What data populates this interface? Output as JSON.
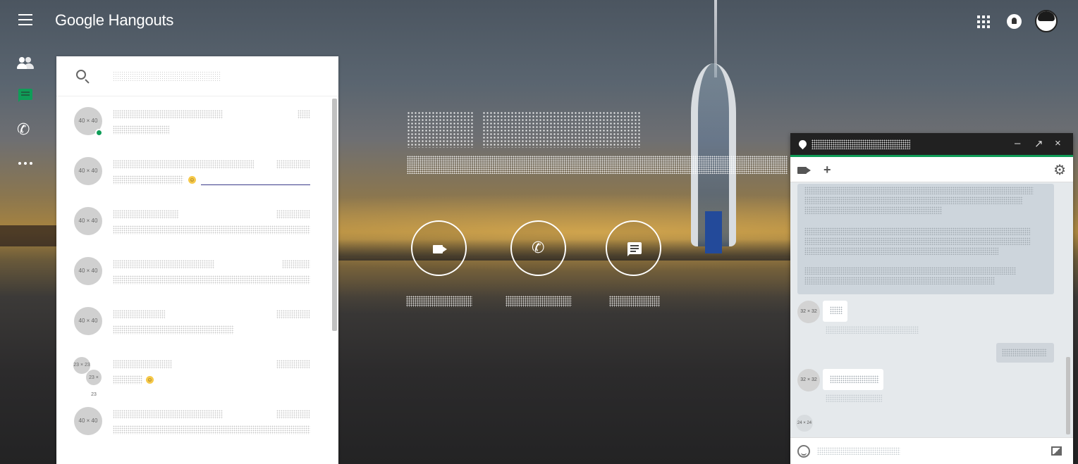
{
  "app": {
    "brand": "Google Hangouts",
    "accent_color": "#0f9d58"
  },
  "topbar": {
    "menu_icon": "hamburger-menu-icon",
    "apps_icon": "apps-grid-icon",
    "notifications_icon": "bell-icon",
    "account_avatar": "user-avatar"
  },
  "left_rail": [
    {
      "icon": "contacts-icon",
      "active": false
    },
    {
      "icon": "conversations-icon",
      "active": true
    },
    {
      "icon": "phone-icon",
      "active": false
    },
    {
      "icon": "more-icon",
      "active": false
    }
  ],
  "search": {
    "placeholder": ""
  },
  "conversations": [
    {
      "avatar_label": "40 × 40",
      "online": true
    },
    {
      "avatar_label": "40 × 40",
      "online": false
    },
    {
      "avatar_label": "40 × 40",
      "online": false
    },
    {
      "avatar_label": "40 × 40",
      "online": false
    },
    {
      "avatar_label": "40 × 40",
      "online": false
    },
    {
      "group_avatars": [
        "23 × 23",
        "23 × 23"
      ],
      "online": false
    },
    {
      "avatar_label": "40 × 40",
      "online": false
    }
  ],
  "hero": {
    "actions": [
      {
        "icon": "video-call-icon"
      },
      {
        "icon": "phone-call-icon"
      },
      {
        "icon": "message-icon"
      }
    ]
  },
  "chat_window": {
    "toolbar_icons": [
      "video-call-icon",
      "add-person-icon",
      "settings-gear-icon"
    ],
    "controls": {
      "minimize": "–",
      "popout": "↗",
      "close": "×"
    },
    "message_avatars": [
      "32 × 32",
      "32 × 32",
      "24 × 24"
    ],
    "input_placeholder": ""
  }
}
